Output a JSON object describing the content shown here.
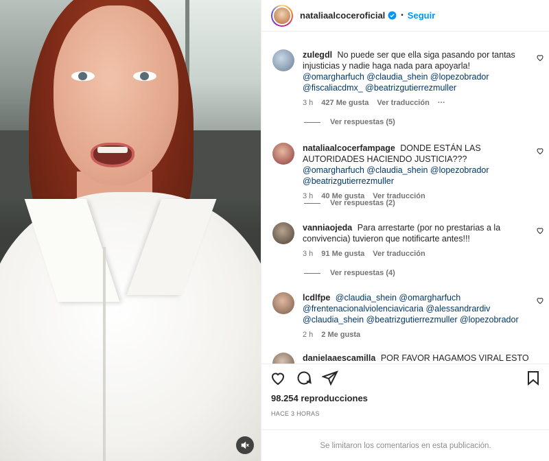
{
  "post": {
    "username": "nataliaalcoceroficial",
    "follow_label": "Seguir",
    "views": "98.254 reproducciones",
    "time_ago": "HACE 3 HORAS",
    "comments_limited": "Se limitaron los comentarios en esta publicación."
  },
  "comments": [
    {
      "user": "zulegdl",
      "text": "No puede ser que ella siga pasando por tantas injusticias y nadie haga nada para apoyarla!",
      "mentions": "@omargharfuch @claudia_shein @lopezobrador @fiscaliacdmx_ @beatrizgutierrezmuller",
      "time": "3 h",
      "likes": "427 Me gusta",
      "translate": "Ver traducción",
      "more": "···",
      "replies": "Ver respuestas (5)"
    },
    {
      "user": "nataliaalcocerfampage",
      "text": "DONDE ESTÁN LAS AUTORIDADES HACIENDO JUSTICIA???",
      "mentions": "@omargharfuch @claudia_shein @lopezobrador @beatrizgutierrezmuller",
      "time": "3 h",
      "likes": "40 Me gusta",
      "translate": "Ver traducción",
      "replies": "Ver respuestas (2)"
    },
    {
      "user": "vanniaojeda",
      "text": "Para arrestarte (por no prestarias a la convivencia) tuvieron que notificarte antes!!!",
      "mentions": "",
      "time": "3 h",
      "likes": "91 Me gusta",
      "translate": "Ver traducción",
      "replies": "Ver respuestas (4)"
    },
    {
      "user": "lcdlfpe",
      "text": "",
      "mentions": "@claudia_shein @omargharfuch @frentenacionalviolenciavicaria @alessandrardiv @claudia_shein @beatrizgutierrezmuller @lopezobrador",
      "time": "2 h",
      "likes": "2 Me gusta"
    },
    {
      "user": "danielaaescamilla",
      "text": "POR FAVOR HAGAMOS VIRAL ESTO NO ES"
    }
  ],
  "icons": {
    "like": "heart-outline-icon",
    "comment": "speech-bubble-icon",
    "share": "paper-plane-icon",
    "save": "bookmark-icon",
    "mute": "speaker-muted-icon",
    "verified": "verified-badge-icon"
  },
  "colors": {
    "link": "#0095f6",
    "mention": "#00376b",
    "muted": "#737373"
  }
}
